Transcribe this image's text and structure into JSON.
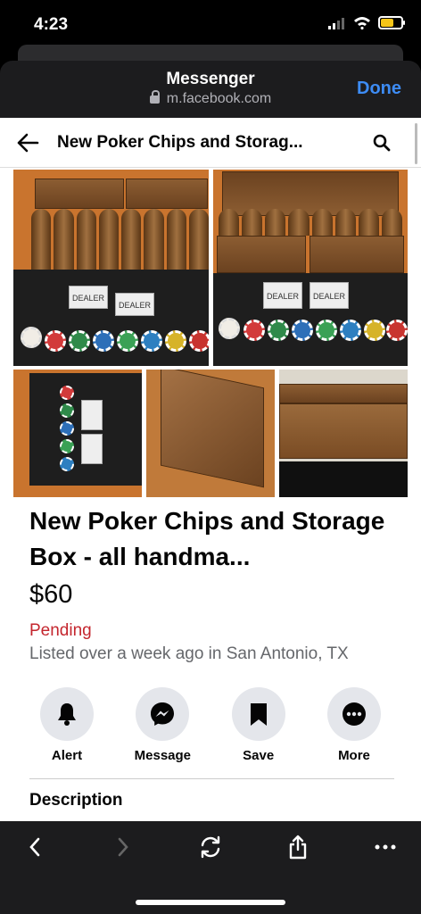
{
  "status_bar": {
    "time": "4:23"
  },
  "sheet": {
    "title": "Messenger",
    "url": "m.facebook.com",
    "done_label": "Done"
  },
  "nav": {
    "title": "New Poker Chips and Storag..."
  },
  "photos": {
    "card_text": "DEALER"
  },
  "listing": {
    "title": "New Poker Chips and Storage Box - all handma...",
    "price": "$60",
    "status": "Pending",
    "location": "Listed over a week ago in San Antonio, TX"
  },
  "actions": [
    {
      "label": "Alert",
      "icon": "bell-icon"
    },
    {
      "label": "Message",
      "icon": "messenger-icon"
    },
    {
      "label": "Save",
      "icon": "bookmark-icon"
    },
    {
      "label": "More",
      "icon": "more-icon"
    }
  ],
  "description": {
    "heading": "Description"
  },
  "colors": {
    "accent_blue": "#3d8cf5",
    "pending_red": "#c4262e",
    "secondary_text": "#65676b"
  }
}
